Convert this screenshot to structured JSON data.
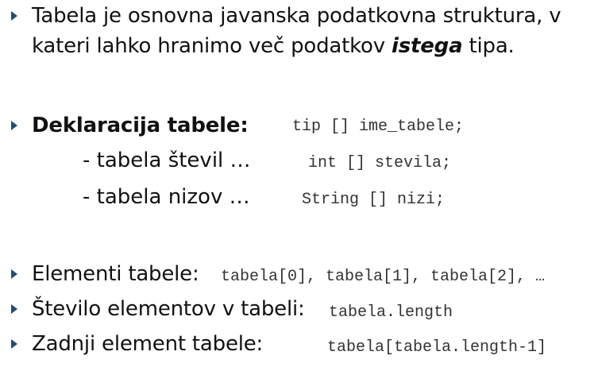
{
  "bullets": {
    "b1": {
      "line1": "Tabela je osnovna javanska podatkovna struktura, v",
      "line2_pre": "kateri lahko hranimo več podatkov ",
      "line2_em": "istega",
      "line2_post": " tipa."
    },
    "b2": {
      "label": "Deklaracija tabele:",
      "code": "tip [] ime_tabele;",
      "sub1_label": "- tabela števil  …",
      "sub1_code": "int [] stevila;",
      "sub2_label": "- tabela nizov  …",
      "sub2_code": "String [] nizi;"
    },
    "b3": {
      "label": "Elementi tabele:",
      "code": "tabela[0], tabela[1], tabela[2], …"
    },
    "b4": {
      "label": "Število elementov v tabeli:",
      "code": "tabela.length"
    },
    "b5": {
      "label": "Zadnji element tabele:",
      "code": "tabela[tabela.length-1]"
    }
  },
  "colors": {
    "bullet": "#1f4e79",
    "text": "#111111",
    "code": "#333333"
  },
  "icons": {
    "bullet": "triangle-right-icon"
  }
}
